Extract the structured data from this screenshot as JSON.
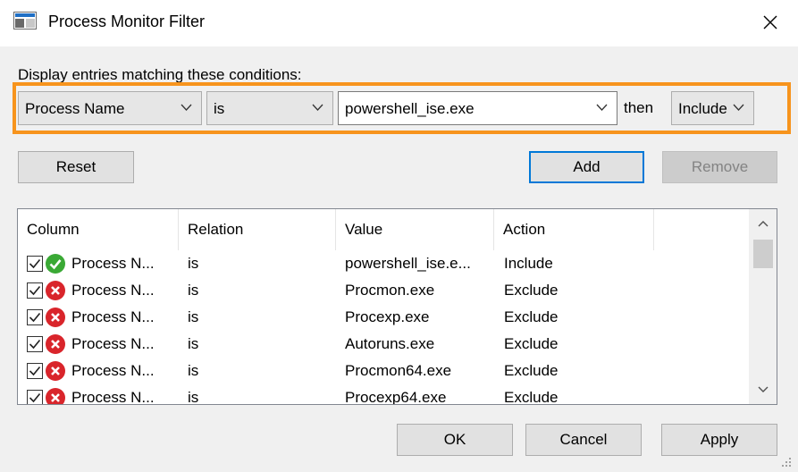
{
  "window": {
    "title": "Process Monitor Filter",
    "icon": "procmon-app-icon",
    "close_icon": "close-icon"
  },
  "caption": "Display entries matching these conditions:",
  "condition": {
    "column": "Process Name",
    "relation": "is",
    "value": "powershell_ise.exe",
    "then_label": "then",
    "action": "Include",
    "highlight_color": "#f7941d"
  },
  "buttons": {
    "reset": "Reset",
    "add": "Add",
    "remove": "Remove",
    "ok": "OK",
    "cancel": "Cancel",
    "apply": "Apply"
  },
  "table": {
    "headers": [
      "Column",
      "Relation",
      "Value",
      "Action"
    ],
    "rows": [
      {
        "checked": true,
        "status": "include-icon",
        "column": "Process N...",
        "relation": "is",
        "value": "powershell_ise.e...",
        "action": "Include"
      },
      {
        "checked": true,
        "status": "exclude-icon",
        "column": "Process N...",
        "relation": "is",
        "value": "Procmon.exe",
        "action": "Exclude"
      },
      {
        "checked": true,
        "status": "exclude-icon",
        "column": "Process N...",
        "relation": "is",
        "value": "Procexp.exe",
        "action": "Exclude"
      },
      {
        "checked": true,
        "status": "exclude-icon",
        "column": "Process N...",
        "relation": "is",
        "value": "Autoruns.exe",
        "action": "Exclude"
      },
      {
        "checked": true,
        "status": "exclude-icon",
        "column": "Process N...",
        "relation": "is",
        "value": "Procmon64.exe",
        "action": "Exclude"
      },
      {
        "checked": true,
        "status": "exclude-icon",
        "column": "Process N...",
        "relation": "is",
        "value": "Procexp64.exe",
        "action": "Exclude"
      }
    ]
  },
  "colors": {
    "accent": "#0078d7",
    "include": "#3aa935",
    "exclude": "#d9252b"
  }
}
